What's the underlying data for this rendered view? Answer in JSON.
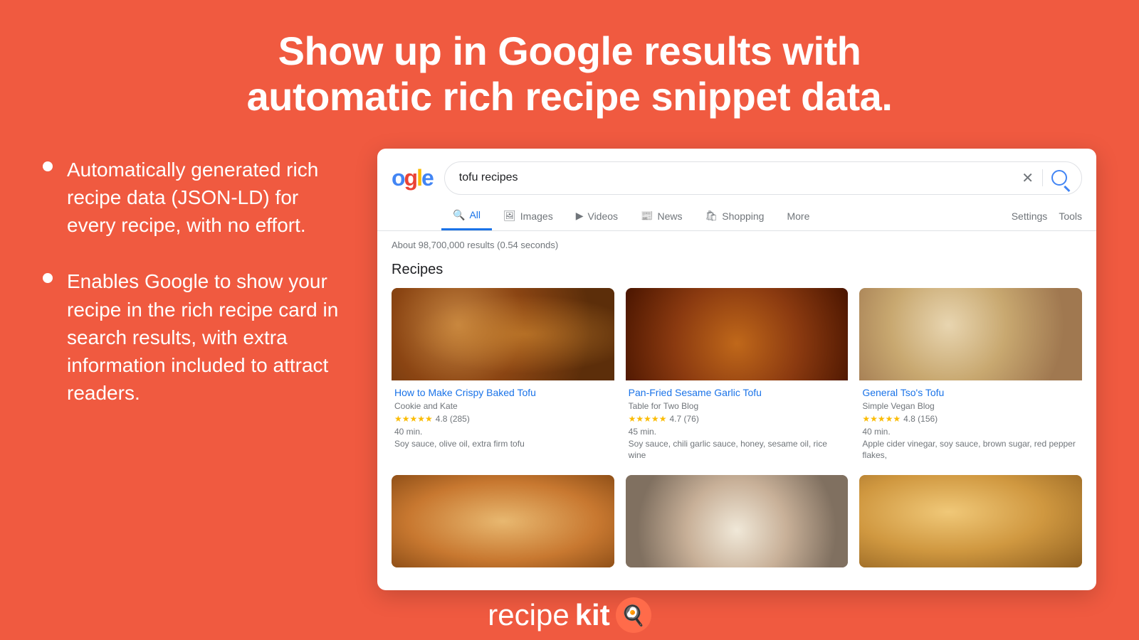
{
  "headline": {
    "line1": "Show up in Google results with",
    "line2": "automatic rich recipe snippet data."
  },
  "bullets": [
    {
      "text": "Automatically generated rich recipe data (JSON-LD) for every recipe, with no effort."
    },
    {
      "text": "Enables Google to show your recipe in the rich recipe card in search results, with extra information included to attract readers."
    }
  ],
  "google_search": {
    "logo_partial": "gle",
    "search_query": "tofu recipes",
    "results_count": "About 98,700,000 results (0.54 seconds)",
    "tabs": [
      {
        "label": "All",
        "icon": "🔍",
        "active": true
      },
      {
        "label": "Images",
        "icon": "🖼",
        "active": false
      },
      {
        "label": "Videos",
        "icon": "▶",
        "active": false
      },
      {
        "label": "News",
        "icon": "📰",
        "active": false
      },
      {
        "label": "Shopping",
        "icon": "🛍",
        "active": false
      },
      {
        "label": "More",
        "icon": "",
        "active": false
      }
    ],
    "settings_label": "Settings",
    "tools_label": "Tools",
    "recipes_heading": "Recipes",
    "recipes": [
      {
        "title": "How to Make Crispy Baked Tofu",
        "source": "Cookie and Kate",
        "rating": "4.8",
        "rating_count": "(285)",
        "time": "40 min.",
        "ingredients": "Soy sauce, olive oil, extra firm tofu",
        "stars": "★★★★★"
      },
      {
        "title": "Pan-Fried Sesame Garlic Tofu",
        "source": "Table for Two Blog",
        "rating": "4.7",
        "rating_count": "(76)",
        "time": "45 min.",
        "ingredients": "Soy sauce, chili garlic sauce, honey, sesame oil, rice wine",
        "stars": "★★★★★"
      },
      {
        "title": "General Tso's Tofu",
        "source": "Simple Vegan Blog",
        "rating": "4.8",
        "rating_count": "(156)",
        "time": "40 min.",
        "ingredients": "Apple cider vinegar, soy sauce, brown sugar, red pepper flakes,",
        "stars": "★★★★★"
      }
    ]
  },
  "brand": {
    "recipe": "recipe",
    "kit": "kit",
    "hat_emoji": "🍳"
  }
}
